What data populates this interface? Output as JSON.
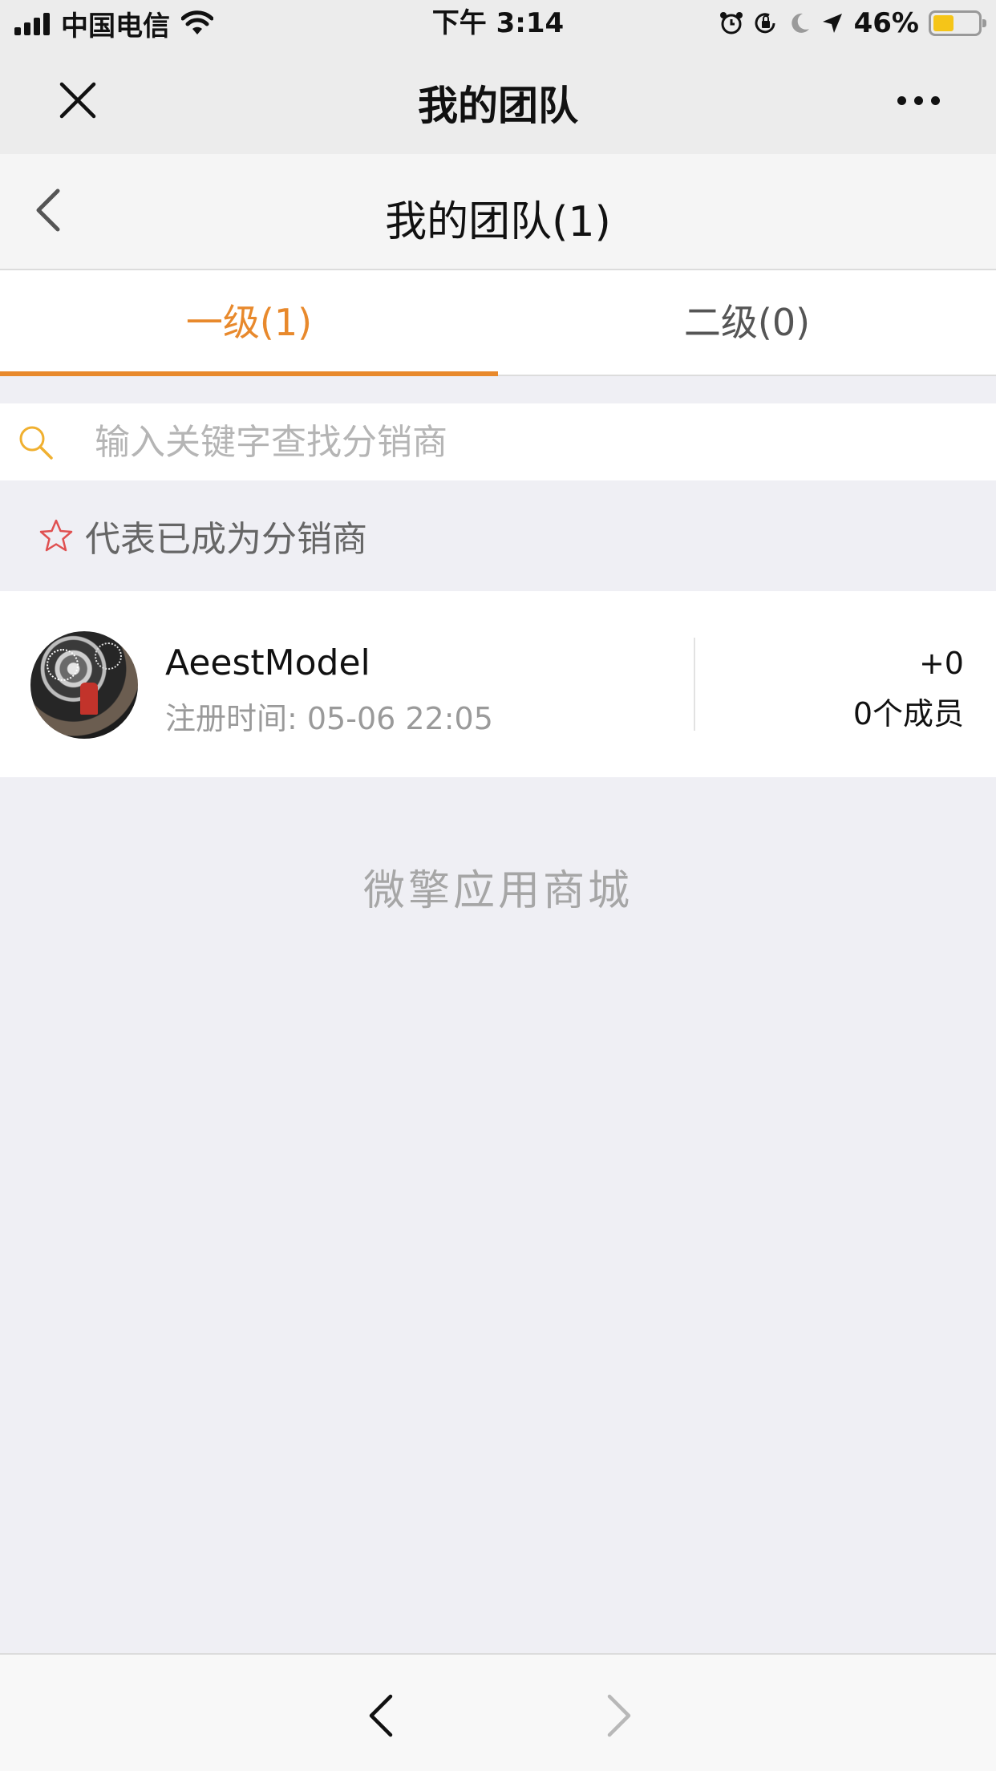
{
  "status_bar": {
    "carrier": "中国电信",
    "time": "下午 3:14",
    "battery_percent": "46%",
    "battery_level": 0.46,
    "icons": [
      "signal-icon",
      "wifi-icon",
      "alarm-icon",
      "rotation-lock-icon",
      "moon-icon",
      "location-icon",
      "battery-icon"
    ]
  },
  "wechat_nav": {
    "title": "我的团队",
    "close_icon": "close-icon",
    "more_icon": "more-icon"
  },
  "page_header": {
    "title": "我的团队(1)",
    "back_icon": "chevron-left-icon"
  },
  "tabs": [
    {
      "label": "一级(1)",
      "active": true
    },
    {
      "label": "二级(0)",
      "active": false
    }
  ],
  "search": {
    "placeholder": "输入关键字查找分销商",
    "value": "",
    "icon": "search-icon"
  },
  "legend": {
    "icon": "star-icon",
    "text": "代表已成为分销商"
  },
  "members": [
    {
      "name": "AeestModel",
      "register_time": "注册时间: 05-06 22:05",
      "plus": "+0",
      "member_count": "0个成员"
    }
  ],
  "brand": "微擎应用商城",
  "toolbar": {
    "back_icon": "chevron-left-icon",
    "forward_icon": "chevron-right-icon"
  },
  "colors": {
    "accent": "#e8892c",
    "star": "#e05050",
    "search_icon": "#f0b030",
    "background": "#efeff4"
  }
}
